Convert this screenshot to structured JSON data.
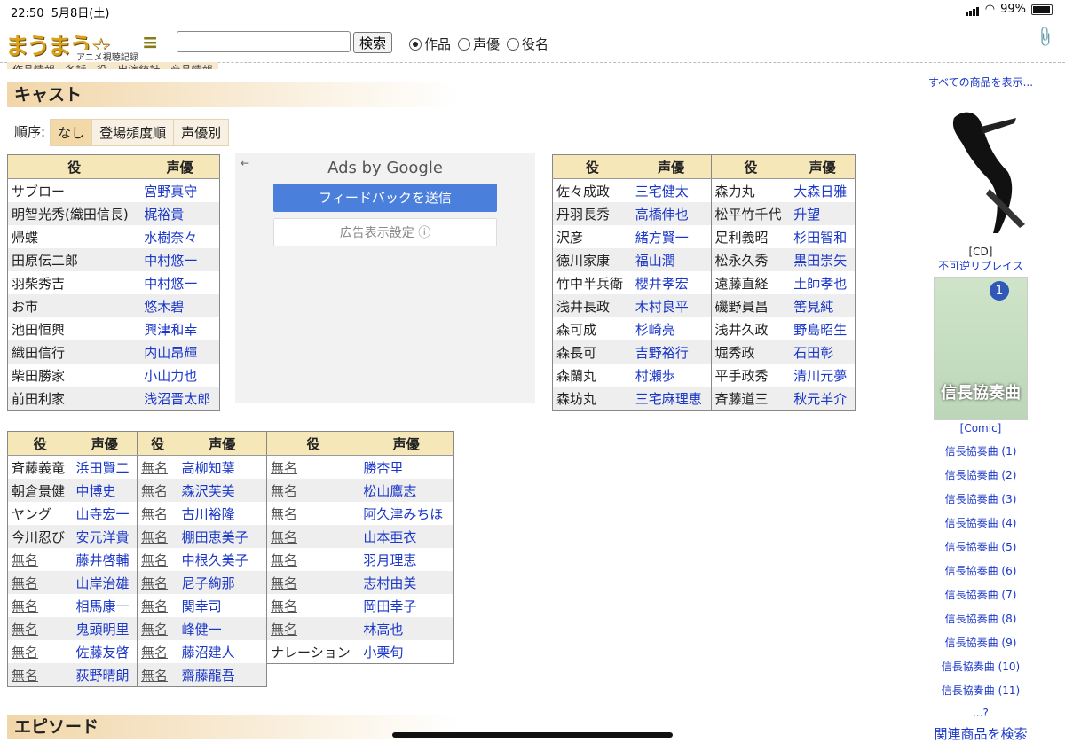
{
  "status": {
    "time": "22:50",
    "date": "5月8日(土)",
    "battery": "99%"
  },
  "header": {
    "logo_text": "まうまう☆",
    "logo_sub": "アニメ視聴記録",
    "search_label": "検索",
    "radios": [
      {
        "label": "作品",
        "selected": true
      },
      {
        "label": "声優",
        "selected": false
      },
      {
        "label": "役名",
        "selected": false
      }
    ]
  },
  "breadcrumbs": "作品情報 · 各話 · 役 · 出演統計 · 商品情報",
  "cast_section": {
    "title": "キャスト",
    "order_label": "順序:",
    "order_options": [
      "なし",
      "登場頻度順",
      "声優別"
    ]
  },
  "table_headers": {
    "role": "役",
    "va": "声優"
  },
  "table1": [
    {
      "role": "サブロー",
      "va": "宮野真守"
    },
    {
      "role": "明智光秀(織田信長)",
      "va": "梶裕貴"
    },
    {
      "role": "帰蝶",
      "va": "水樹奈々"
    },
    {
      "role": "田原伝二郎",
      "va": "中村悠一"
    },
    {
      "role": "羽柴秀吉",
      "va": "中村悠一"
    },
    {
      "role": "お市",
      "va": "悠木碧"
    },
    {
      "role": "池田恒興",
      "va": "興津和幸"
    },
    {
      "role": "織田信行",
      "va": "内山昂輝"
    },
    {
      "role": "柴田勝家",
      "va": "小山力也"
    },
    {
      "role": "前田利家",
      "va": "浅沼晋太郎"
    }
  ],
  "ad": {
    "by_label": "Ads by Google",
    "feedback": "フィードバックを送信",
    "settings": "広告表示設定 ⓘ"
  },
  "table2": [
    {
      "r1": "佐々成政",
      "v1": "三宅健太",
      "r2": "森力丸",
      "v2": "大森日雅"
    },
    {
      "r1": "丹羽長秀",
      "v1": "高橋伸也",
      "r2": "松平竹千代",
      "v2": "升望"
    },
    {
      "r1": "沢彦",
      "v1": "緒方賢一",
      "r2": "足利義昭",
      "v2": "杉田智和"
    },
    {
      "r1": "徳川家康",
      "v1": "福山潤",
      "r2": "松永久秀",
      "v2": "黒田崇矢"
    },
    {
      "r1": "竹中半兵衛",
      "v1": "櫻井孝宏",
      "r2": "遠藤直経",
      "v2": "土師孝也"
    },
    {
      "r1": "浅井長政",
      "v1": "木村良平",
      "r2": "磯野員昌",
      "v2": "筈見純"
    },
    {
      "r1": "森可成",
      "v1": "杉崎亮",
      "r2": "浅井久政",
      "v2": "野島昭生"
    },
    {
      "r1": "森長可",
      "v1": "吉野裕行",
      "r2": "堀秀政",
      "v2": "石田彰"
    },
    {
      "r1": "森蘭丸",
      "v1": "村瀬歩",
      "r2": "平手政秀",
      "v2": "清川元夢"
    },
    {
      "r1": "森坊丸",
      "v1": "三宅麻理恵",
      "r2": "斉藤道三",
      "v2": "秋元羊介"
    }
  ],
  "table3": [
    {
      "role": "斉藤義竜",
      "va": "浜田賢二"
    },
    {
      "role": "朝倉景健",
      "va": "中博史"
    },
    {
      "role": "ヤング",
      "va": "山寺宏一"
    },
    {
      "role": "今川忍び",
      "va": "安元洋貴"
    },
    {
      "role": "無名",
      "va": "藤井啓輔"
    },
    {
      "role": "無名",
      "va": "山岸治雄"
    },
    {
      "role": "無名",
      "va": "相馬康一"
    },
    {
      "role": "無名",
      "va": "鬼頭明里"
    },
    {
      "role": "無名",
      "va": "佐藤友啓"
    },
    {
      "role": "無名",
      "va": "荻野晴朗"
    }
  ],
  "table4": [
    {
      "role": "無名",
      "va": "高柳知葉"
    },
    {
      "role": "無名",
      "va": "森沢芙美"
    },
    {
      "role": "無名",
      "va": "古川裕隆"
    },
    {
      "role": "無名",
      "va": "棚田恵美子"
    },
    {
      "role": "無名",
      "va": "中根久美子"
    },
    {
      "role": "無名",
      "va": "尼子絢那"
    },
    {
      "role": "無名",
      "va": "関幸司"
    },
    {
      "role": "無名",
      "va": "峰健一"
    },
    {
      "role": "無名",
      "va": "藤沼建人"
    },
    {
      "role": "無名",
      "va": "齋藤龍吾"
    }
  ],
  "table5": [
    {
      "role": "無名",
      "va": "勝杏里"
    },
    {
      "role": "無名",
      "va": "松山鷹志"
    },
    {
      "role": "無名",
      "va": "阿久津みちほ"
    },
    {
      "role": "無名",
      "va": "山本亜衣"
    },
    {
      "role": "無名",
      "va": "羽月理恵"
    },
    {
      "role": "無名",
      "va": "志村由美"
    },
    {
      "role": "無名",
      "va": "岡田幸子"
    },
    {
      "role": "無名",
      "va": "林高也"
    },
    {
      "role": "ナレーション",
      "va": "小栗旬"
    }
  ],
  "episode_section": {
    "title": "エピソード"
  },
  "sidebar": {
    "show_all": "すべての商品を表示...",
    "cd_label": "[CD]",
    "cd_title": "不可逆リプレイス",
    "comic_cover_title": "信長協奏曲",
    "comic_cover_num": "1",
    "comic_label": "[Comic]",
    "volumes": [
      "信長協奏曲 (1)",
      "信長協奏曲 (2)",
      "信長協奏曲 (3)",
      "信長協奏曲 (4)",
      "信長協奏曲 (5)",
      "信長協奏曲 (6)",
      "信長協奏曲 (7)",
      "信長協奏曲 (8)",
      "信長協奏曲 (9)",
      "信長協奏曲 (10)",
      "信長協奏曲 (11)"
    ],
    "more": "...?",
    "related": "関連商品を検索"
  }
}
